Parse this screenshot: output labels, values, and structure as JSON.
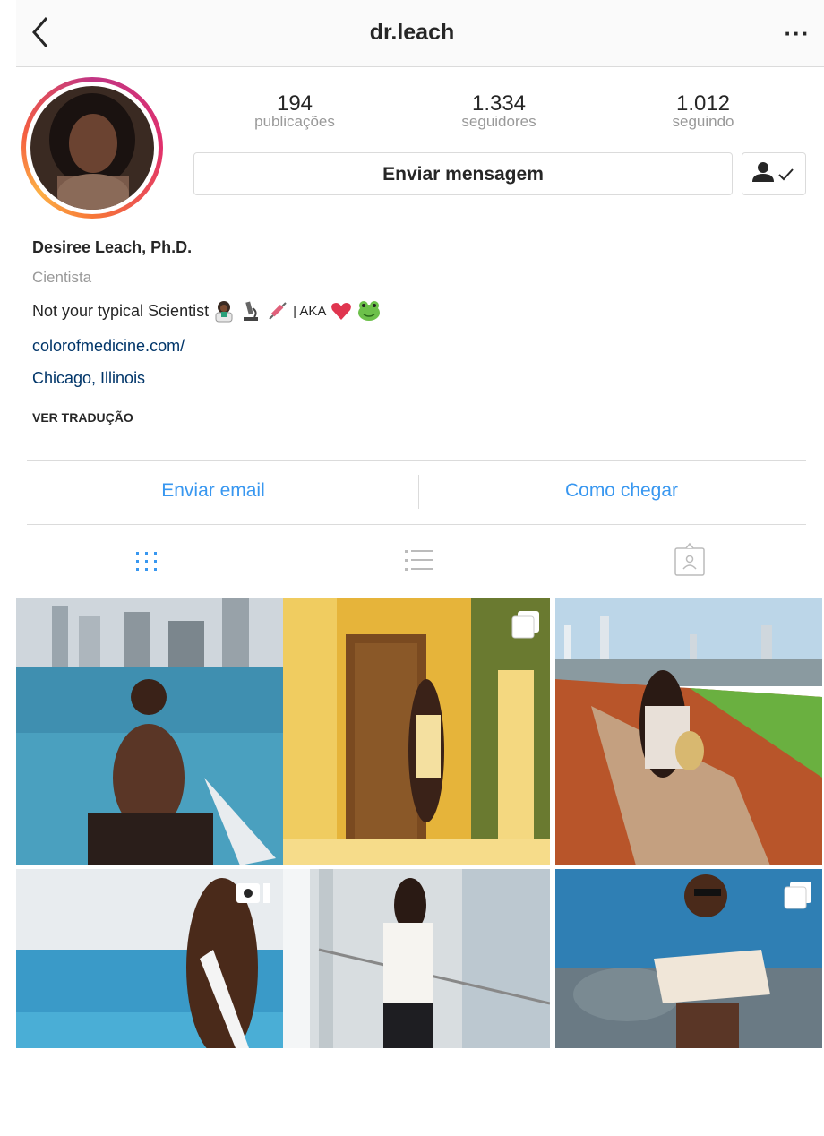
{
  "header": {
    "title": "dr.leach"
  },
  "stats": [
    {
      "value": "194",
      "label": "publicações"
    },
    {
      "value": "1.334",
      "label": "seguidores"
    },
    {
      "value": "1.012",
      "label": "seguindo"
    }
  ],
  "actions": {
    "message_label": "Enviar mensagem"
  },
  "bio": {
    "name": "Desiree Leach, Ph.D.",
    "category": "Cientista",
    "text_before": "Not your typical Scientist",
    "text_middle": "| AKA",
    "link": "colorofmedicine.com/",
    "location": "Chicago, Illinois",
    "translate": "VER TRADUÇÃO"
  },
  "contact": {
    "email": "Enviar email",
    "directions": "Como chegar"
  },
  "tabs": [
    "grid-icon",
    "list-icon",
    "tagged-icon"
  ],
  "grid": [
    {
      "kind": "photo",
      "badge": ""
    },
    {
      "kind": "carousel",
      "badge": "carousel-icon"
    },
    {
      "kind": "photo",
      "badge": ""
    },
    {
      "kind": "video",
      "badge": "video-icon"
    },
    {
      "kind": "photo",
      "badge": ""
    },
    {
      "kind": "carousel",
      "badge": "carousel-icon"
    }
  ],
  "colors": {
    "link": "#003569",
    "action": "#3897f0",
    "muted": "#999999",
    "border": "#dbdbdb"
  }
}
